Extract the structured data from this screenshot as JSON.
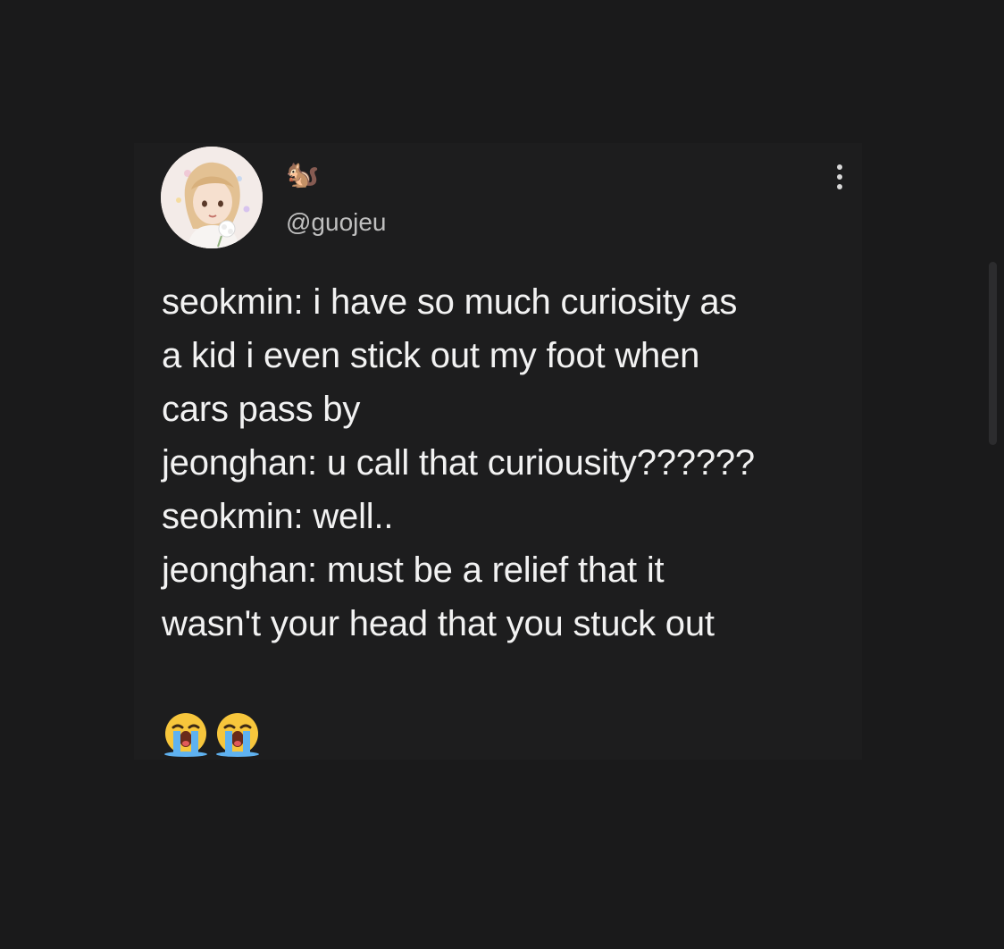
{
  "post": {
    "author": {
      "display_name": "🐿️",
      "handle": "@guojeu",
      "avatar_icon": "anime-avatar"
    },
    "menu_icon": "more-vertical-icon",
    "lines": [
      "seokmin: i have so much curiosity as",
      "a kid i even stick out my foot when",
      "cars pass by",
      "jeonghan: u call that curiousity??????",
      "seokmin: well..",
      "jeonghan: must be a relief that it",
      "wasn't your head that you stuck out"
    ],
    "reactions": [
      "😭",
      "😭"
    ]
  },
  "colors": {
    "background": "#1a1a1b",
    "card": "#1d1d1e",
    "text": "#f2f2f2",
    "handle": "#bfbfbf"
  }
}
